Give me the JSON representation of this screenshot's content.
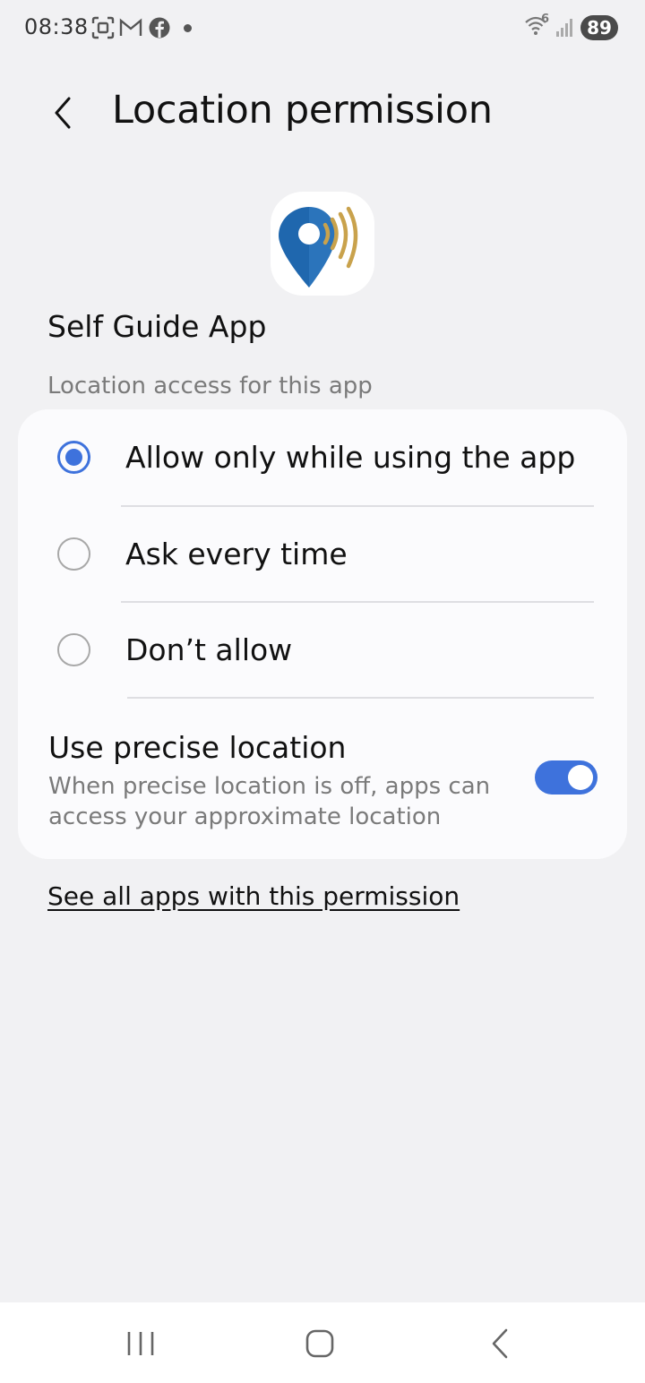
{
  "status_bar": {
    "time": "08:38",
    "icons": [
      "screenshot-icon",
      "gmail-icon",
      "facebook-icon",
      "notification-dot",
      "wifi-icon",
      "signal-icon"
    ],
    "wifi_label": "6",
    "battery": "89"
  },
  "header": {
    "title": "Location permission"
  },
  "app": {
    "name": "Self Guide App",
    "icon": "location-pin-signal-icon"
  },
  "section": {
    "label": "Location access for this app"
  },
  "options": [
    {
      "label": "Allow only while using the app",
      "selected": true
    },
    {
      "label": "Ask every time",
      "selected": false
    },
    {
      "label": "Don’t allow",
      "selected": false
    }
  ],
  "precise_location": {
    "title": "Use precise location",
    "description": "When precise location is off, apps can access your approximate location",
    "enabled": true
  },
  "link": {
    "label": "See all apps with this permission"
  },
  "nav": {
    "icons": [
      "recents-icon",
      "home-icon",
      "back-icon"
    ]
  },
  "colors": {
    "accent": "#3e72dc",
    "background": "#f1f1f3",
    "card": "#fbfbfd",
    "secondary_text": "#7a7a7a",
    "app_icon_blue": "#1f67ae",
    "app_icon_gold": "#c9a24c"
  }
}
